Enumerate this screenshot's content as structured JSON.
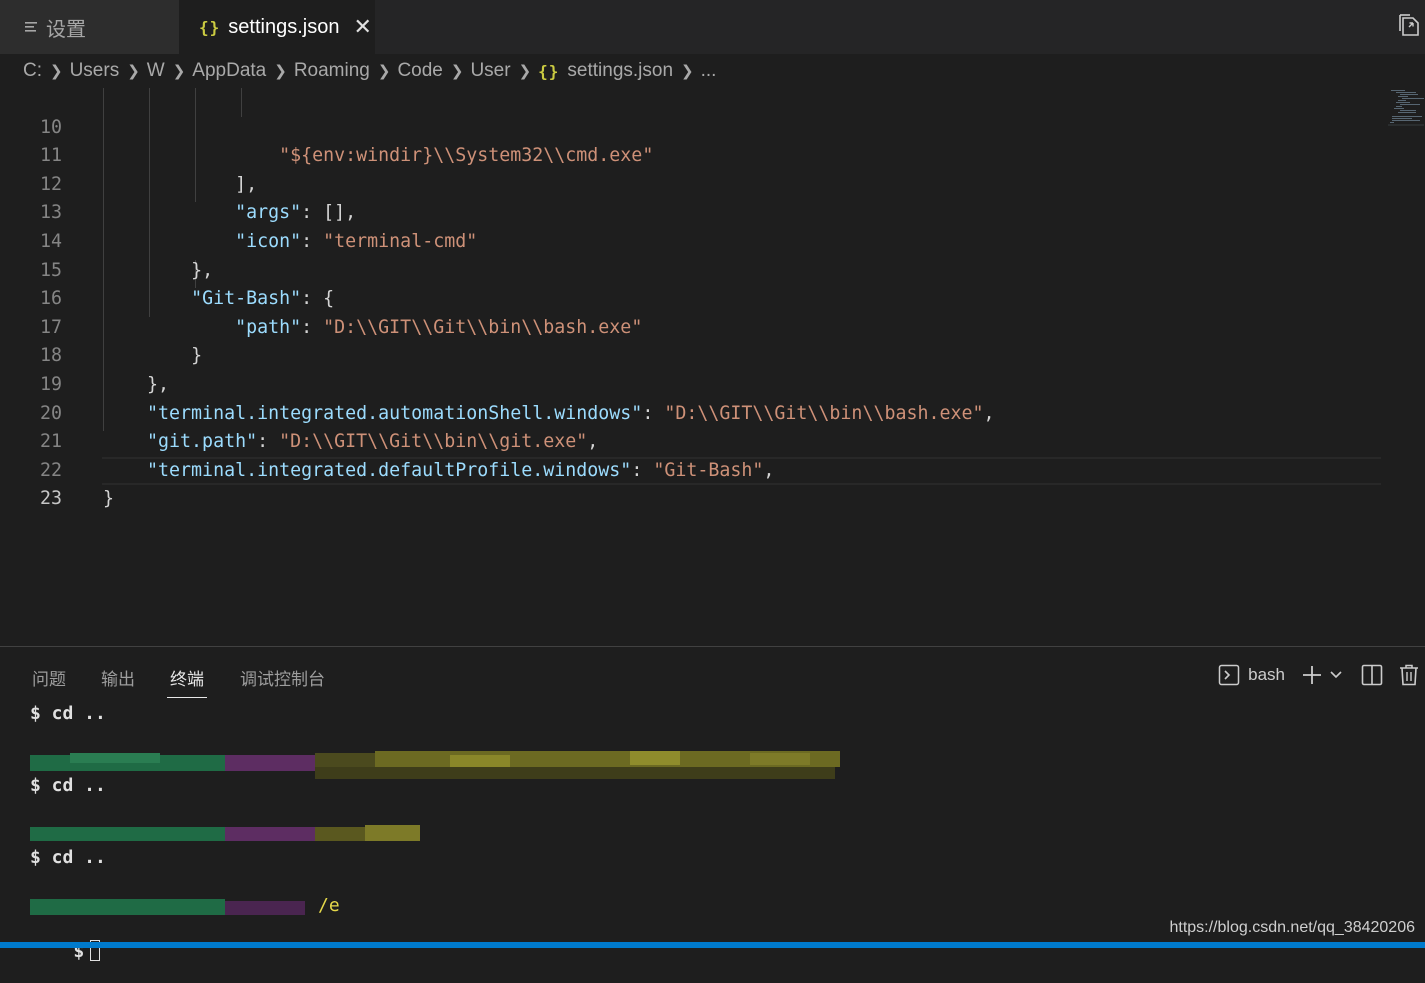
{
  "tabs": {
    "settings_label": "设置",
    "json_label": "settings.json",
    "close_glyph": "✕",
    "brace_glyph": "{}"
  },
  "breadcrumb": [
    "C:",
    "Users",
    "W",
    "AppData",
    "Roaming",
    "Code",
    "User",
    "settings.json",
    "..."
  ],
  "editor": {
    "active_line": 23,
    "lines": [
      {
        "n": "10"
      },
      {
        "n": "11"
      },
      {
        "n": "12"
      },
      {
        "n": "13"
      },
      {
        "n": "14"
      },
      {
        "n": "15"
      },
      {
        "n": "16"
      },
      {
        "n": "17"
      },
      {
        "n": "18"
      },
      {
        "n": "19"
      },
      {
        "n": "20"
      },
      {
        "n": "21"
      },
      {
        "n": "22"
      },
      {
        "n": "23"
      }
    ],
    "text": {
      "l10_s": "\"${env:windir}\\\\System32\\\\cmd.exe\"",
      "l11_p": "],",
      "l12_k": "\"args\"",
      "l12_p": ": [],",
      "l13_k": "\"icon\"",
      "l13_p": ": ",
      "l13_s": "\"terminal-cmd\"",
      "l14_p": "},",
      "l15_k": "\"Git-Bash\"",
      "l15_p": ": {",
      "l16_k": "\"path\"",
      "l16_p": ": ",
      "l16_s": "\"D:\\\\GIT\\\\Git\\\\bin\\\\bash.exe\"",
      "l17_p": "}",
      "l18_p": "},",
      "l19_k": "\"terminal.integrated.automationShell.windows\"",
      "l19_p": ": ",
      "l19_s": "\"D:\\\\GIT\\\\Git\\\\bin\\\\bash.exe\"",
      "l19_p2": ",",
      "l20_k": "\"git.path\"",
      "l20_p": ": ",
      "l20_s": "\"D:\\\\GIT\\\\Git\\\\bin\\\\git.exe\"",
      "l20_p2": ",",
      "l21_k": "\"terminal.integrated.defaultProfile.windows\"",
      "l21_p": ": ",
      "l21_s": "\"Git-Bash\"",
      "l21_p2": ",",
      "l22_p": "}"
    }
  },
  "panel": {
    "tabs": [
      "问题",
      "输出",
      "终端",
      "调试控制台"
    ],
    "active_tab": "终端",
    "shell_label": "bash",
    "terminal_lines": [
      "$ cd ..",
      "$ cd ..",
      "$ cd ..",
      "/e",
      "$"
    ],
    "watermark": "https://blog.csdn.net/qq_38420206"
  },
  "colors": {
    "editor_bg": "#1e1e1e",
    "key": "#9cdcfe",
    "string": "#ce9178",
    "status_bar": "#007acc",
    "json_icon": "#cbcb41"
  }
}
